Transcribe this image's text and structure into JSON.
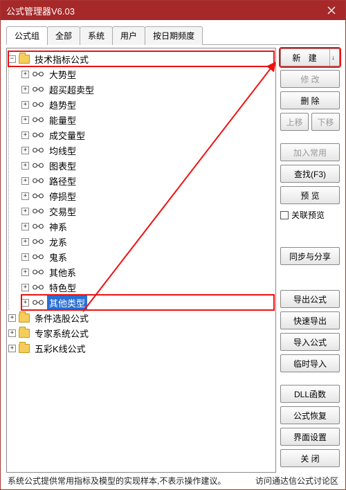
{
  "window": {
    "title": "公式管理器V6.03"
  },
  "tabs": [
    "公式组",
    "全部",
    "系统",
    "用户",
    "按日期频度"
  ],
  "activeTab": 0,
  "tree": {
    "root": {
      "label": "技术指标公式",
      "expanded": true
    },
    "children": [
      "大势型",
      "超买超卖型",
      "趋势型",
      "能量型",
      "成交量型",
      "均线型",
      "图表型",
      "路径型",
      "停损型",
      "交易型",
      "神系",
      "龙系",
      "鬼系",
      "其他系",
      "特色型",
      "其他类型"
    ],
    "selectedIndex": 15,
    "siblings": [
      "条件选股公式",
      "专家系统公式",
      "五彩K线公式"
    ]
  },
  "buttons": {
    "new": "新  建",
    "modify": "修  改",
    "delete": "删  除",
    "moveUp": "上移",
    "moveDown": "下移",
    "addFav": "加入常用",
    "find": "查找(F3)",
    "preview": "预  览",
    "linkPreview": "关联预览",
    "sync": "同步与分享",
    "export": "导出公式",
    "quickExport": "快速导出",
    "import": "导入公式",
    "tempImport": "临时导入",
    "dll": "DLL函数",
    "restore": "公式恢复",
    "ui": "界面设置",
    "close": "关  闭"
  },
  "status": {
    "left": "系统公式提供常用指标及模型的实现样本,不表示操作建议。",
    "right": "访问通达信公式讨论区"
  }
}
